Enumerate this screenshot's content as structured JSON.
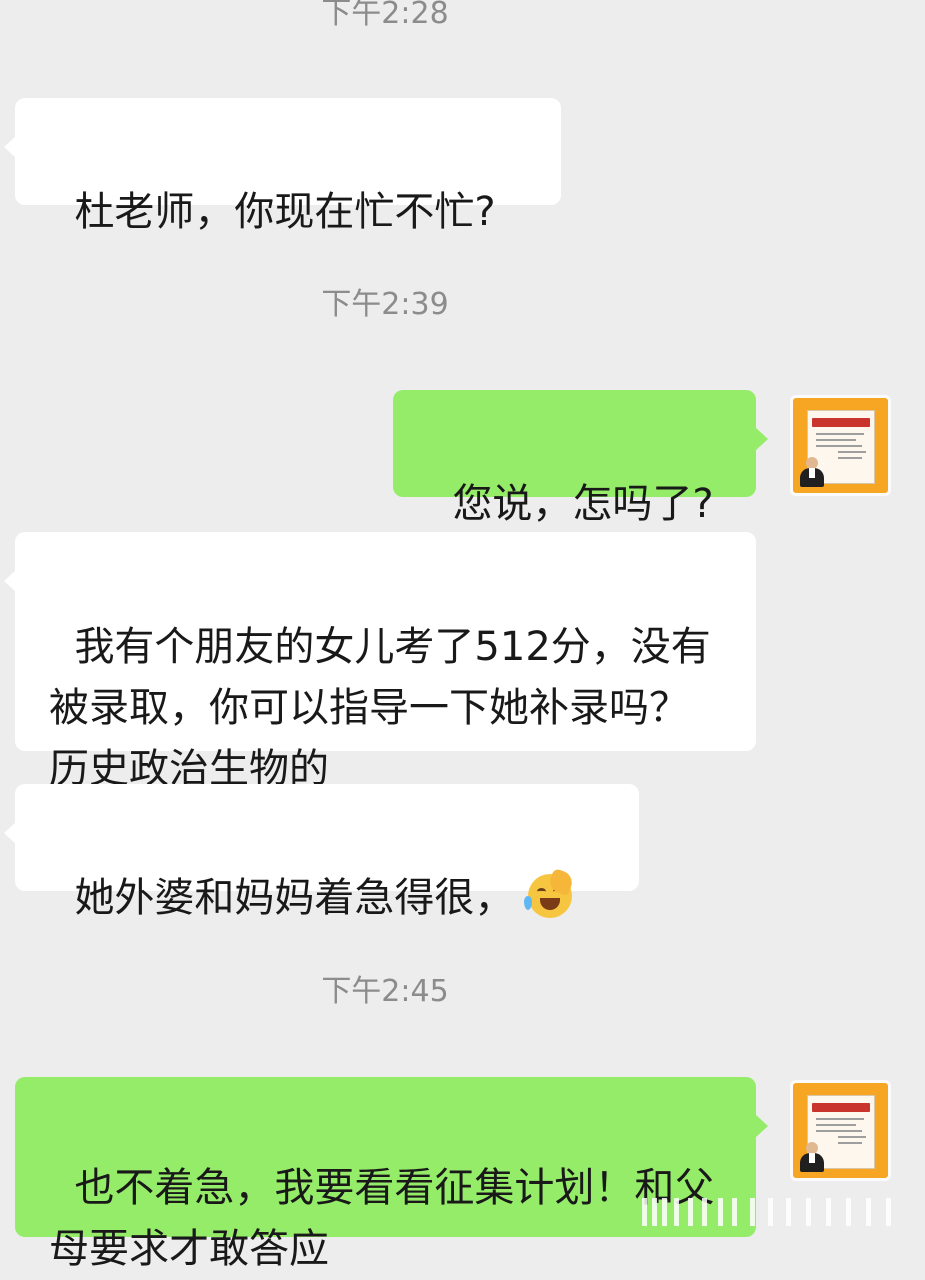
{
  "messages": [
    {
      "type": "timestamp",
      "text": "下午2:28"
    },
    {
      "type": "incoming",
      "text": "杜老师，你现在忙不忙?"
    },
    {
      "type": "timestamp",
      "text": "下午2:39"
    },
    {
      "type": "outgoing",
      "text": "您说，怎吗了?"
    },
    {
      "type": "incoming",
      "text": "我有个朋友的女儿考了512分，没有被录取，你可以指导一下她补录吗？历史政治生物的"
    },
    {
      "type": "incoming",
      "text": "她外婆和妈妈着急得很，",
      "emoji": "face-palm-crying-emoji"
    },
    {
      "type": "timestamp",
      "text": "下午2:45"
    },
    {
      "type": "outgoing",
      "text": "也不着急，我要看看征集计划！和父母要求才敢答应"
    }
  ],
  "avatar_icon": "certificate-avatar-icon",
  "colors": {
    "background": "#ededed",
    "incoming_bubble": "#ffffff",
    "outgoing_bubble": "#95ec69",
    "timestamp_text": "#8c8c8c",
    "avatar_frame": "#f6a623"
  }
}
